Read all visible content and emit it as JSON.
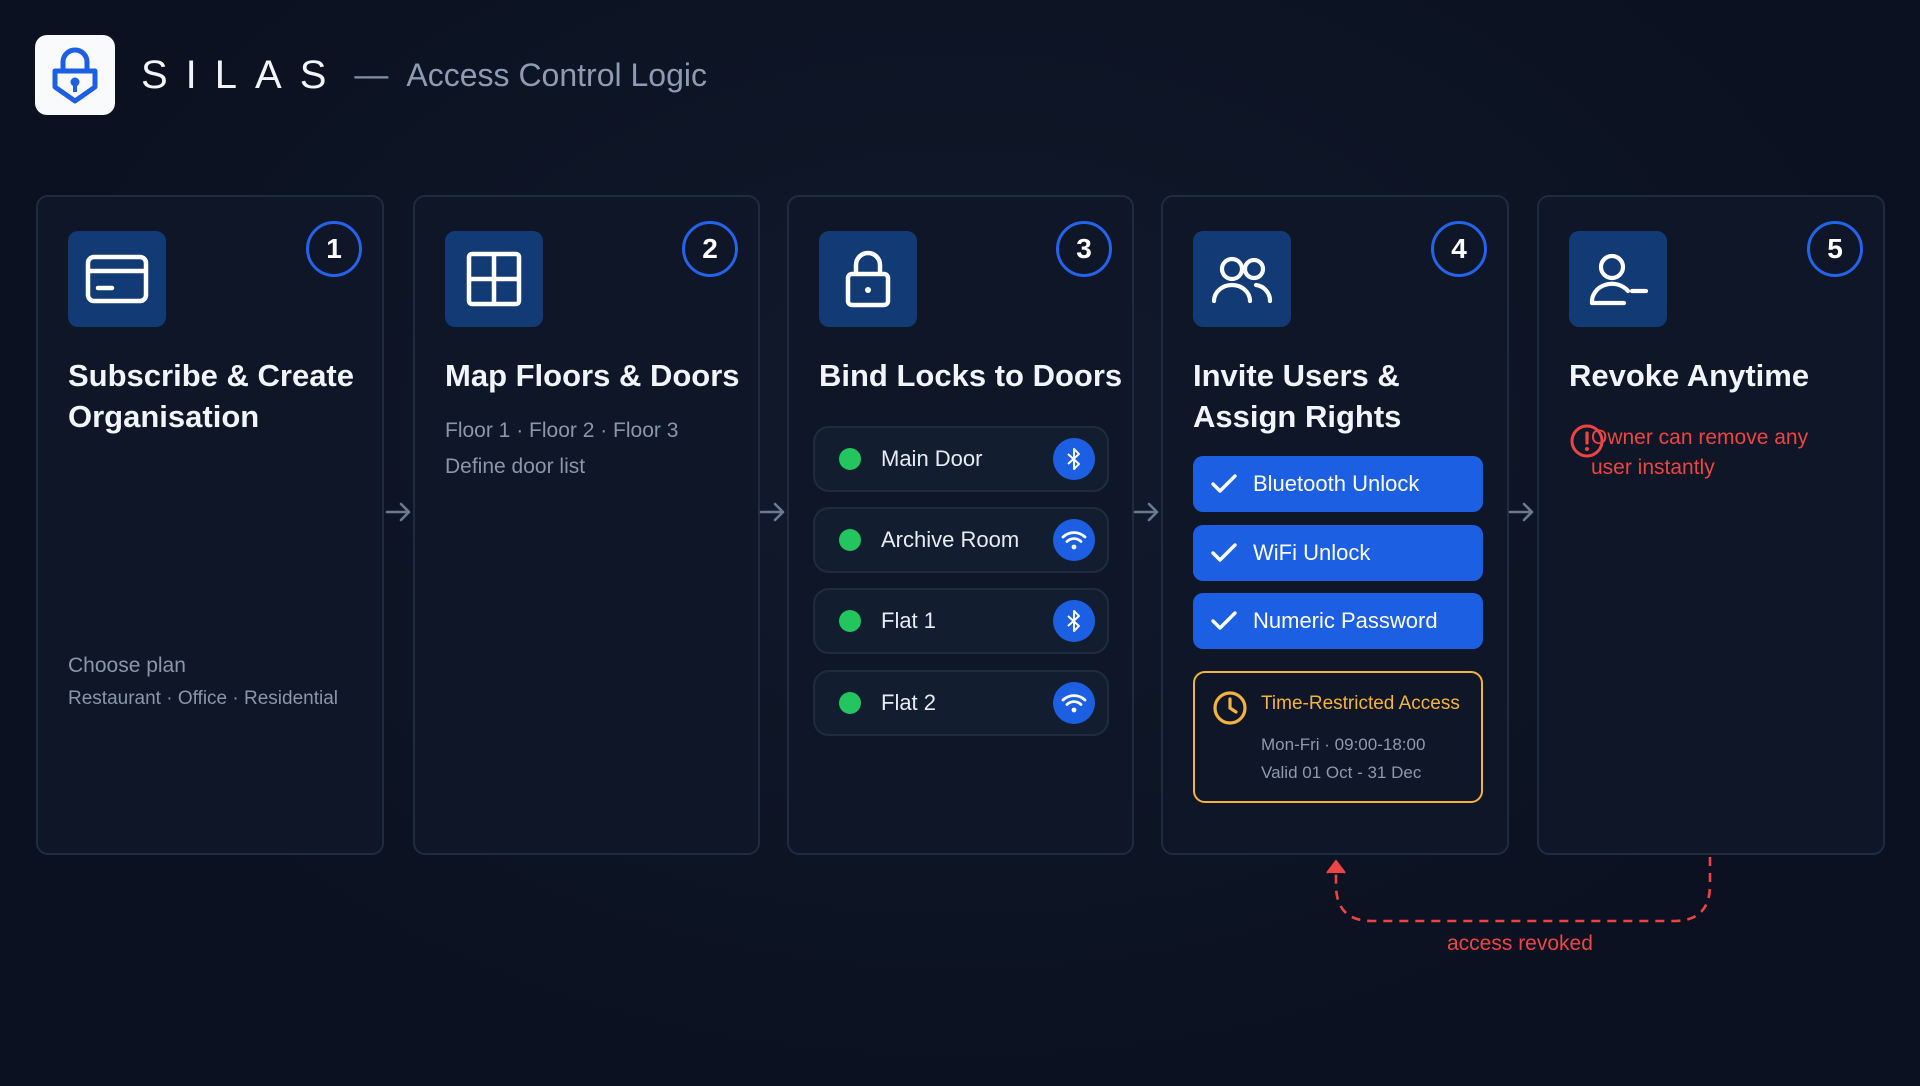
{
  "header": {
    "brand": "SILAS",
    "separator": "—",
    "subtitle": "Access Control Logic"
  },
  "steps": [
    {
      "number": "1",
      "icon": "credit-card-icon",
      "title": "Subscribe & Create Organisation",
      "lines": [
        "Choose plan",
        "Restaurant · Office · Residential"
      ]
    },
    {
      "number": "2",
      "icon": "floor-plan-icon",
      "title": "Map Floors & Doors",
      "lines": [
        "Floor 1 · Floor 2 · Floor 3",
        "Define door list"
      ]
    },
    {
      "number": "3",
      "icon": "lock-icon",
      "title": "Bind Locks to Doors",
      "doors": [
        {
          "name": "Main Door",
          "connection": "bluetooth-icon"
        },
        {
          "name": "Archive Room",
          "connection": "wifi-icon"
        },
        {
          "name": "Flat 1",
          "connection": "bluetooth-icon"
        },
        {
          "name": "Flat 2",
          "connection": "wifi-icon"
        }
      ]
    },
    {
      "number": "4",
      "icon": "users-icon",
      "title": "Invite Users & Assign Rights",
      "rights": [
        "Bluetooth Unlock",
        "WiFi Unlock",
        "Numeric Password"
      ],
      "time_restriction": {
        "title": "Time-Restricted Access",
        "schedule": "Mon-Fri · 09:00-18:00",
        "validity": "Valid 01 Oct - 31 Dec"
      }
    },
    {
      "number": "5",
      "icon": "user-minus-icon",
      "title": "Revoke Anytime",
      "note": "Owner can remove any user instantly"
    }
  ],
  "revoke_link_label": "access revoked",
  "colors": {
    "background": "#0b1120",
    "card_border": "#1f2c40",
    "accent_blue": "#1d5fe3",
    "icon_tile": "#123a74",
    "status_green": "#22c55e",
    "time_amber": "#f5b33e",
    "alert_red": "#ef4444"
  }
}
